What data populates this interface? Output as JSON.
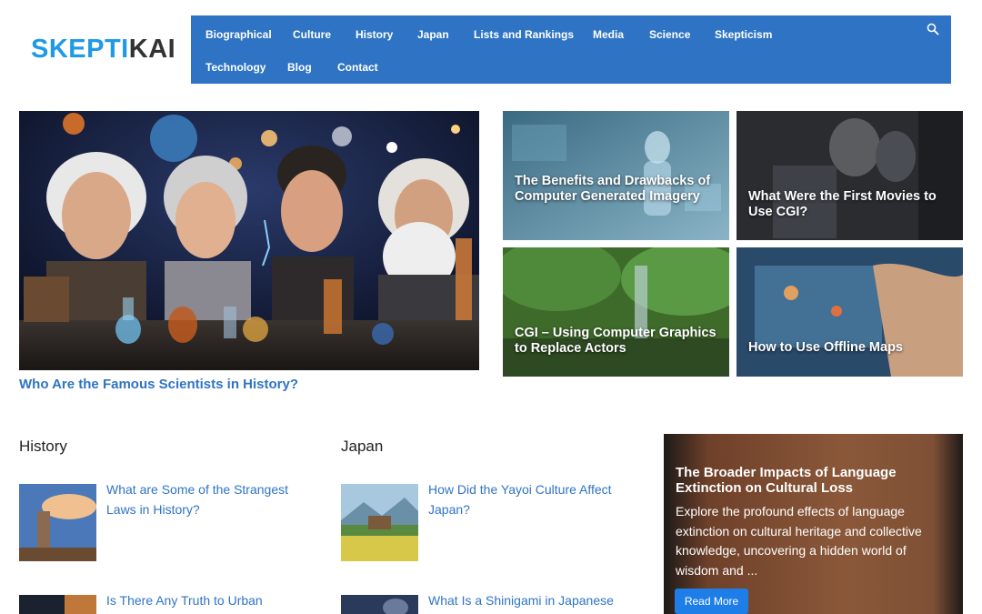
{
  "brand": {
    "logo_part1": "SKEPTI",
    "logo_part2": "KAI",
    "accent": "#1e9ae6",
    "nav_bg": "#2f74c4"
  },
  "nav": {
    "items": [
      "Biographical",
      "Culture",
      "History",
      "Japan",
      "Lists and Rankings",
      "Media",
      "Science",
      "Skepticism",
      "Technology",
      "Blog",
      "Contact"
    ],
    "search_icon": "search-icon"
  },
  "hero": {
    "title": "Who Are the Famous Scientists in History?"
  },
  "tiles": [
    {
      "title": "The Benefits and Drawbacks of Computer Generated Imagery"
    },
    {
      "title": "What Were the First Movies to Use CGI?"
    },
    {
      "title": "CGI – Using Computer Graphics to Replace Actors"
    },
    {
      "title": "How to Use Offline Maps"
    }
  ],
  "history": {
    "heading": "History",
    "items": [
      "What are Some of the Strangest Laws in History?",
      "Is There Any Truth to Urban"
    ]
  },
  "japan": {
    "heading": "Japan",
    "items": [
      "How Did the Yayoi Culture Affect Japan?",
      "What Is a Shinigami in Japanese"
    ]
  },
  "feature": {
    "title": "The Broader Impacts of Language Extinction on Cultural Loss",
    "desc": "Explore the profound effects of language extinction on cultural heritage and collective knowledge, uncovering a hidden world of wisdom and ...",
    "button": "Read More"
  }
}
